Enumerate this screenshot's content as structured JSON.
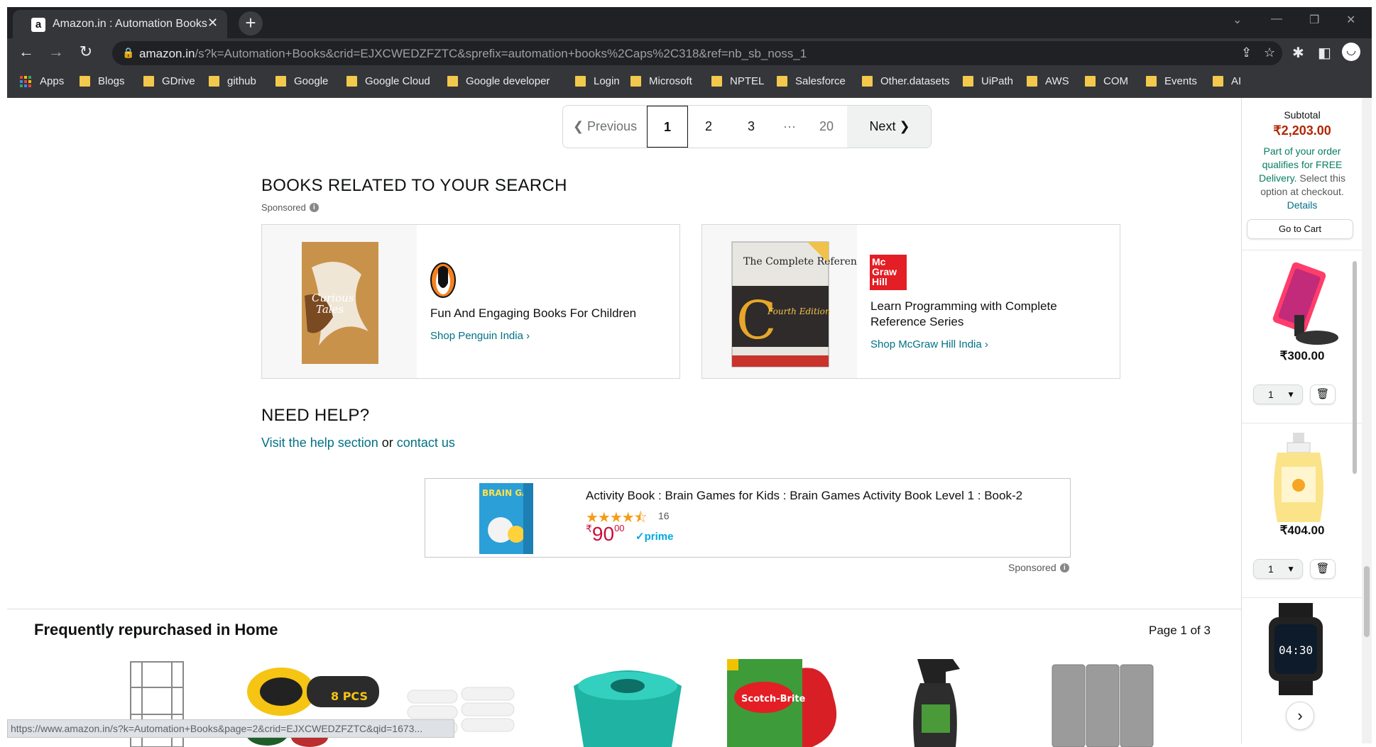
{
  "browser": {
    "tab_title": "Amazon.in : Automation Books",
    "url_domain": "amazon.in",
    "url_path": "/s?k=Automation+Books&crid=EJXCWEDZFZTC&sprefix=automation+books%2Caps%2C318&ref=nb_sb_noss_1",
    "bookmarks": [
      "Apps",
      "Blogs",
      "GDrive",
      "github",
      "Google",
      "Google Cloud",
      "Google developer",
      "Login",
      "Microsoft",
      "NPTEL",
      "Salesforce",
      "Other.datasets",
      "UiPath",
      "AWS",
      "COM",
      "Events",
      "AI"
    ],
    "status_url": "https://www.amazon.in/s?k=Automation+Books&page=2&crid=EJXCWEDZFZTC&qid=1673..."
  },
  "pagination": {
    "previous": "Previous",
    "pages": [
      "1",
      "2",
      "3"
    ],
    "ellipsis": "···",
    "last": "20",
    "next": "Next"
  },
  "related": {
    "title": "BOOKS RELATED TO YOUR SEARCH",
    "sponsored": "Sponsored",
    "cards": [
      {
        "headline": "Fun And Engaging Books For Children",
        "shop": "Shop Penguin India ›"
      },
      {
        "headline": "Learn Programming with Complete Reference Series",
        "shop": "Shop McGraw Hill India ›",
        "logo_text": "Mc Graw Hill",
        "book_title": "The Complete Reference",
        "book_edition": "Fourth Edition"
      }
    ]
  },
  "help": {
    "title": "NEED HELP?",
    "link1": "Visit the help section",
    "or": " or ",
    "link2": "contact us"
  },
  "product_ad": {
    "title": "Activity Book : Brain Games for Kids : Brain Games Activity Book Level 1 : Book-2",
    "rating": 4.5,
    "review_count": "16",
    "price_symbol": "₹",
    "price_whole": "90",
    "price_fraction": "00",
    "prime": "✓prime",
    "sponsored": "Sponsored",
    "cover_text": "BRAIN GAMES"
  },
  "frequently": {
    "title": "Frequently repurchased in Home",
    "page": "Page 1 of 3",
    "brush_label": "8 PCS",
    "scotch_label": "Scotch-Brite"
  },
  "cart": {
    "subtotal_label": "Subtotal",
    "subtotal": "₹2,203.00",
    "free_delivery": "Part of your order qualifies for FREE Delivery.",
    "select_option": " Select this option at checkout.",
    "details": "Details",
    "go_to_cart": "Go to Cart",
    "items": [
      {
        "price": "₹300.00",
        "qty": "1"
      },
      {
        "price": "₹404.00",
        "qty": "1"
      }
    ],
    "watch_time": "04:30"
  },
  "colors": {
    "price_red": "#b12704",
    "green": "#067d62",
    "link": "#007185",
    "star": "#f49d16"
  }
}
